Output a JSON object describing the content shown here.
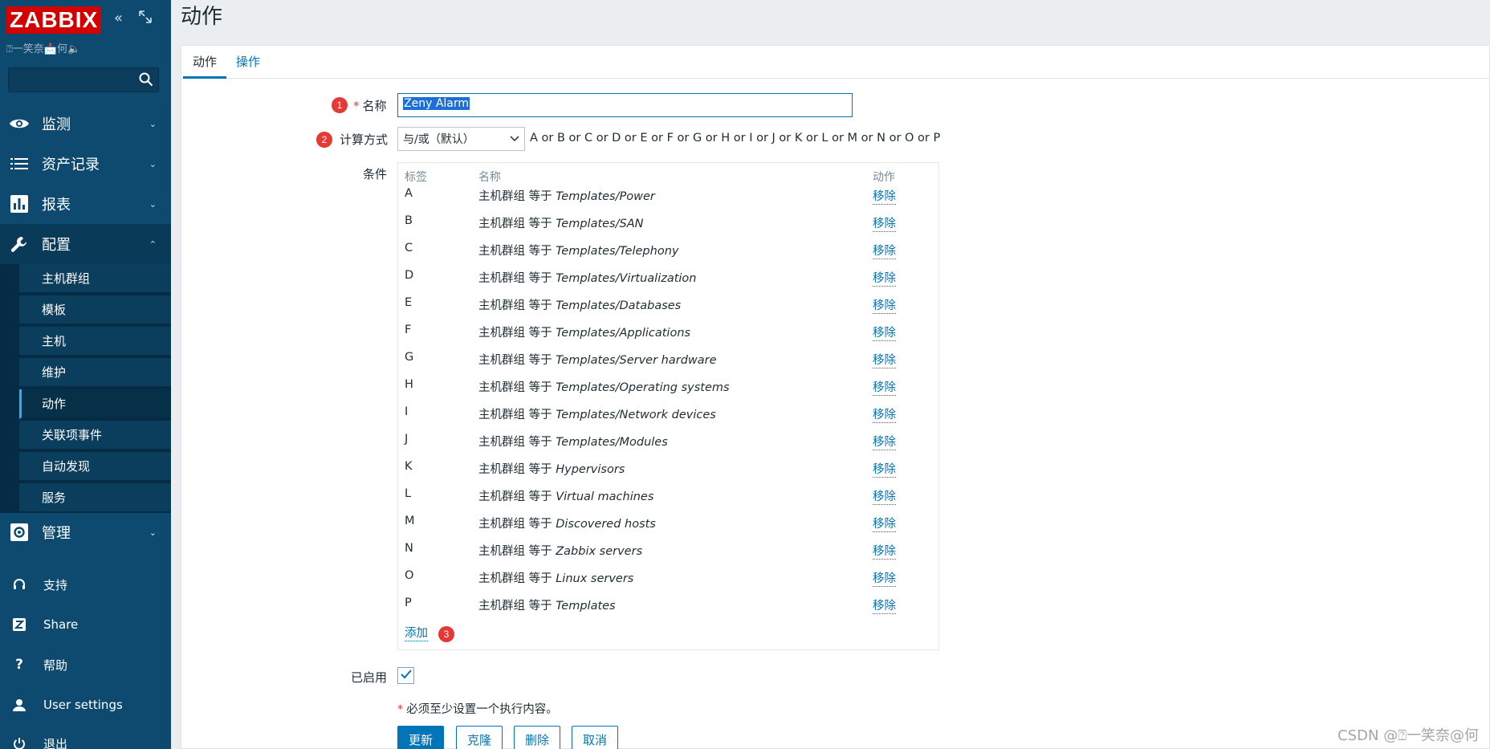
{
  "sidebar": {
    "logo": "ZABBIX",
    "user_line": "⍰一笑奈📩何🔈",
    "search_placeholder": "",
    "menu": [
      {
        "label": "监测",
        "icon": "eye-icon"
      },
      {
        "label": "资产记录",
        "icon": "list-icon"
      },
      {
        "label": "报表",
        "icon": "bar-chart-icon"
      },
      {
        "label": "配置",
        "icon": "wrench-icon"
      },
      {
        "label": "管理",
        "icon": "gear-icon"
      }
    ],
    "submenu": [
      "主机群组",
      "模板",
      "主机",
      "维护",
      "动作",
      "关联项事件",
      "自动发现",
      "服务"
    ],
    "bottom": [
      {
        "label": "支持",
        "icon": "headset-icon"
      },
      {
        "label": "Share",
        "icon": "share-z-icon"
      },
      {
        "label": "帮助",
        "icon": "question-icon"
      },
      {
        "label": "User settings",
        "icon": "user-icon"
      },
      {
        "label": "退出",
        "icon": "power-icon"
      }
    ]
  },
  "page": {
    "title": "动作",
    "tabs": [
      "动作",
      "操作"
    ]
  },
  "form": {
    "name_label": "名称",
    "name_required": "*",
    "name_value": "Zeny Alarm",
    "calc_label": "计算方式",
    "calc_value": "与/或（默认）",
    "calc_expression": "A or B or C or D or E or F or G or H or I or J or K or L or M or N or O or P",
    "conditions_label": "条件",
    "cond_headers": {
      "label": "标签",
      "name": "名称",
      "action": "动作"
    },
    "cond_prefix": "主机群组 等于",
    "remove_label": "移除",
    "conditions": [
      {
        "label": "A",
        "value": "Templates/Power"
      },
      {
        "label": "B",
        "value": "Templates/SAN"
      },
      {
        "label": "C",
        "value": "Templates/Telephony"
      },
      {
        "label": "D",
        "value": "Templates/Virtualization"
      },
      {
        "label": "E",
        "value": "Templates/Databases"
      },
      {
        "label": "F",
        "value": "Templates/Applications"
      },
      {
        "label": "G",
        "value": "Templates/Server hardware"
      },
      {
        "label": "H",
        "value": "Templates/Operating systems"
      },
      {
        "label": "I",
        "value": "Templates/Network devices"
      },
      {
        "label": "J",
        "value": "Templates/Modules"
      },
      {
        "label": "K",
        "value": "Hypervisors"
      },
      {
        "label": "L",
        "value": "Virtual machines"
      },
      {
        "label": "M",
        "value": "Discovered hosts"
      },
      {
        "label": "N",
        "value": "Zabbix servers"
      },
      {
        "label": "O",
        "value": "Linux servers"
      },
      {
        "label": "P",
        "value": "Templates"
      }
    ],
    "add_label": "添加",
    "enabled_label": "已启用",
    "enabled": true,
    "note_star": "*",
    "note": "必须至少设置一个执行内容。",
    "buttons": {
      "update": "更新",
      "clone": "克隆",
      "delete": "删除",
      "cancel": "取消"
    }
  },
  "annotations": [
    "1",
    "2",
    "3"
  ],
  "watermark": "CSDN @⍰一笑奈@何",
  "colors": {
    "sidebar": "#0e4a6f",
    "accent": "#0275b8",
    "logo": "#d40000",
    "badge": "#e53935"
  }
}
